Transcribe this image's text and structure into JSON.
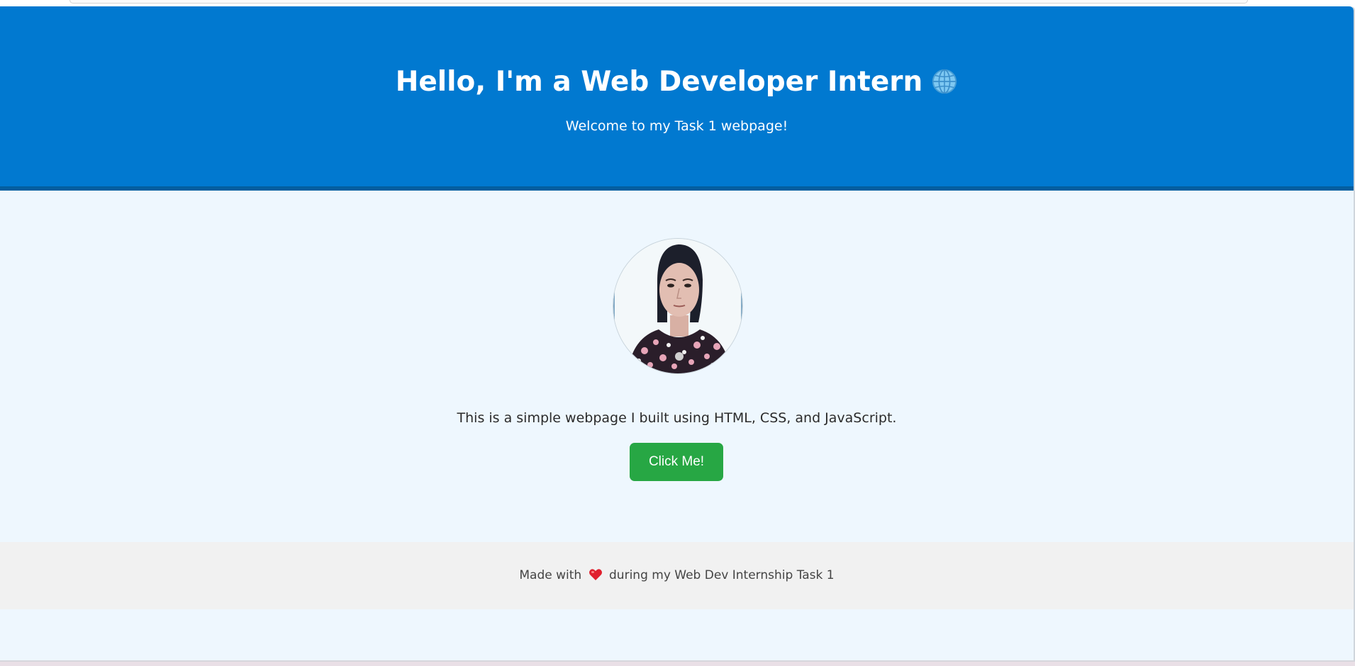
{
  "header": {
    "title": "Hello, I'm a Web Developer Intern",
    "subtitle": "Welcome to my Task 1 webpage!",
    "title_icon": "globe-icon"
  },
  "main": {
    "avatar_alt": "profile photo",
    "intro": "This is a simple webpage I built using HTML, CSS, and JavaScript.",
    "button_label": "Click Me!"
  },
  "footer": {
    "prefix": "Made with",
    "suffix": "during my Web Dev Internship Task 1",
    "icon": "heart-icon"
  },
  "colors": {
    "header_bg": "#0179d0",
    "page_bg": "#eef7fe",
    "button_bg": "#27a744",
    "footer_bg": "#f1f1f1"
  }
}
